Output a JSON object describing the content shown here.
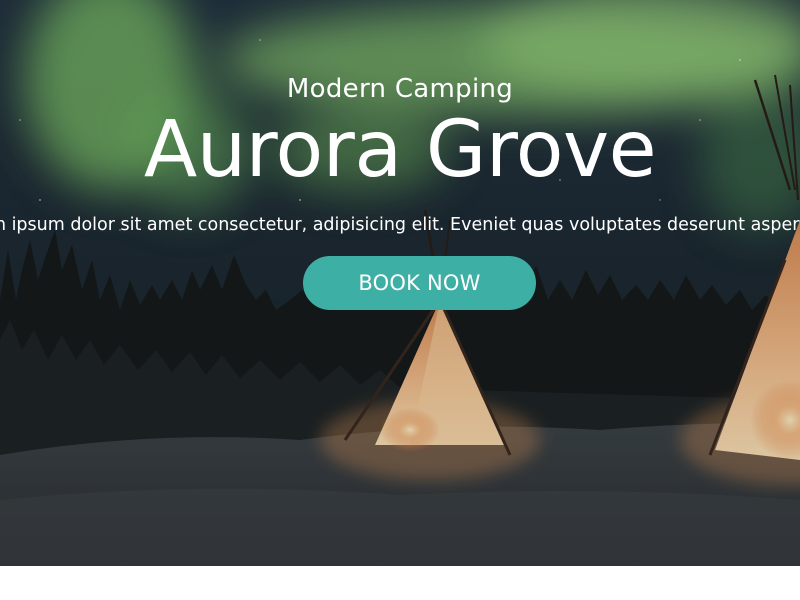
{
  "hero": {
    "subtitle": "Modern Camping",
    "title": "Aurora Grove",
    "tagline": "Lorem ipsum dolor sit amet consectetur, adipisicing elit. Eveniet quas voluptates deserunt asperiores!",
    "cta_label": "BOOK NOW"
  },
  "colors": {
    "accent": "#3eafa4",
    "aurora": "#7dc46a",
    "sky": "#1f2d38",
    "tent_glow": "#f2b27a",
    "snow": "#4a4f52"
  }
}
